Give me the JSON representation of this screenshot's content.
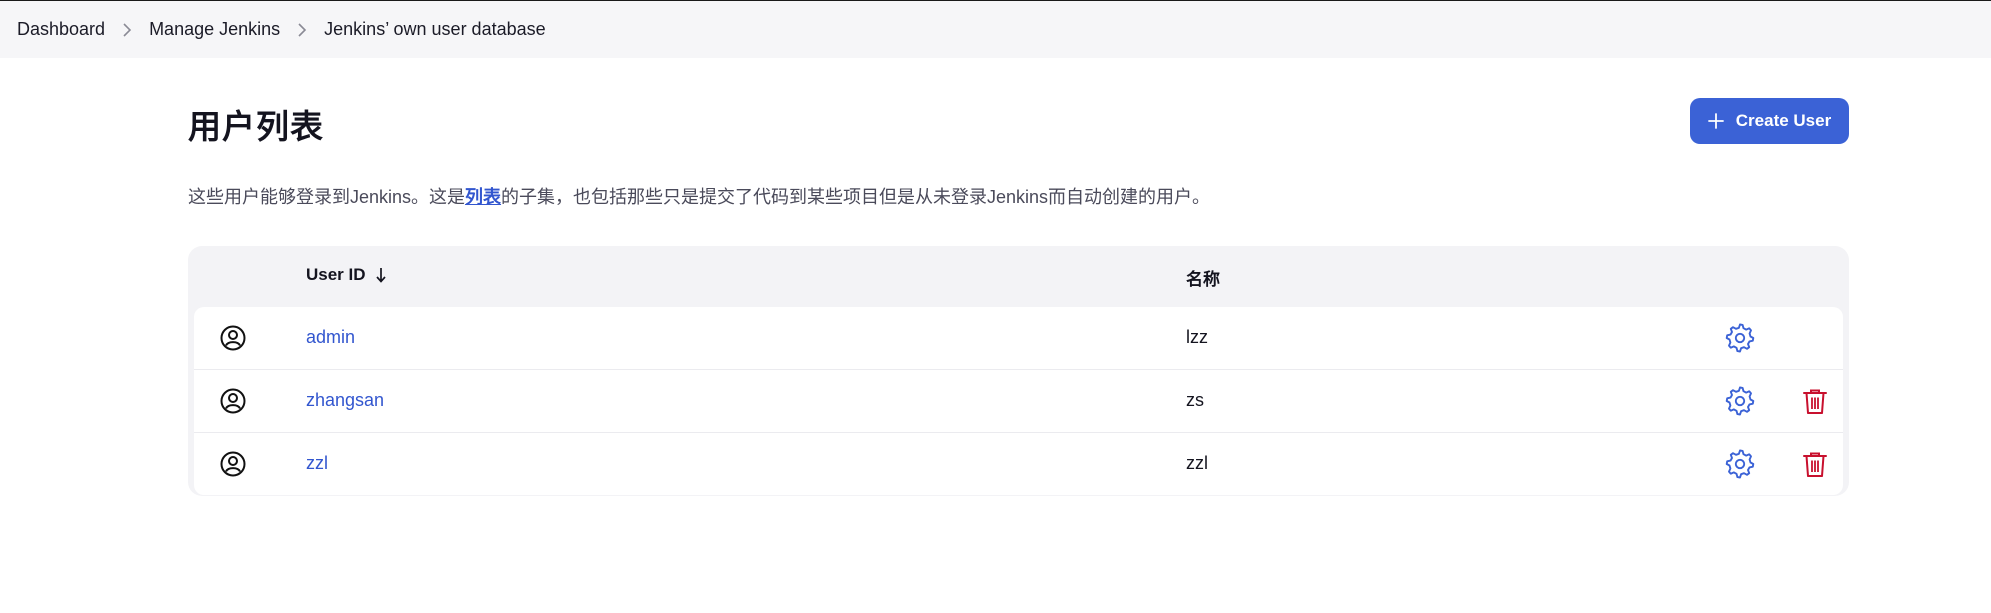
{
  "breadcrumb": {
    "items": [
      {
        "label": "Dashboard"
      },
      {
        "label": "Manage Jenkins"
      },
      {
        "label": "Jenkins’ own user database"
      }
    ]
  },
  "page": {
    "title": "用户列表",
    "create_button_label": "Create User",
    "description_before": "这些用户能够登录到Jenkins。这是",
    "description_link": "列表",
    "description_after": "的子集，也包括那些只是提交了代码到某些项目但是从未登录Jenkins而自动创建的用户。"
  },
  "table": {
    "headers": {
      "user_id": "User ID",
      "name": "名称"
    },
    "rows": [
      {
        "user_id": "admin",
        "name": "lzz",
        "deletable": false
      },
      {
        "user_id": "zhangsan",
        "name": "zs",
        "deletable": true
      },
      {
        "user_id": "zzl",
        "name": "zzl",
        "deletable": true
      }
    ]
  },
  "colors": {
    "accent": "#3b62d6",
    "link": "#3256cf",
    "danger": "#c8102e",
    "breadcrumb_bg": "#f6f6f8",
    "table_bg": "#f3f3f6"
  },
  "icons": {
    "breadcrumb_separator": "chevron-right-icon",
    "create": "plus-icon",
    "sort": "arrow-down-icon",
    "avatar": "user-circle-icon",
    "settings": "gear-icon",
    "delete": "trash-icon"
  }
}
